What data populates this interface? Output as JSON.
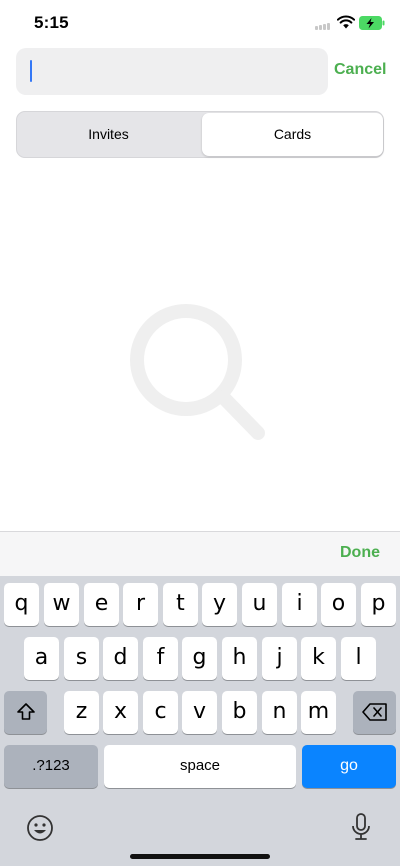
{
  "status_bar": {
    "time": "5:15",
    "icons": [
      "cellular-signal-icon",
      "wifi-icon",
      "battery-charging-icon"
    ]
  },
  "search": {
    "value": "",
    "placeholder": "",
    "cancel_label": "Cancel"
  },
  "segments": {
    "items": [
      {
        "label": "Invites",
        "selected": false
      },
      {
        "label": "Cards",
        "selected": true
      }
    ]
  },
  "empty_state": {
    "icon": "search-icon"
  },
  "accessory": {
    "done_label": "Done"
  },
  "keyboard": {
    "row1": [
      "q",
      "w",
      "e",
      "r",
      "t",
      "y",
      "u",
      "i",
      "o",
      "p"
    ],
    "row2": [
      "a",
      "s",
      "d",
      "f",
      "g",
      "h",
      "j",
      "k",
      "l"
    ],
    "row3": [
      "z",
      "x",
      "c",
      "v",
      "b",
      "n",
      "m"
    ],
    "numbers_label": ".?123",
    "space_label": "space",
    "go_label": "go",
    "shift_icon": "shift-icon",
    "delete_icon": "backspace-icon",
    "emoji_icon": "emoji-icon",
    "mic_icon": "microphone-icon"
  },
  "colors": {
    "accent": "#4caf50",
    "caret": "#3478f6",
    "go_key": "#0a84ff",
    "keyboard_bg": "#d3d6dc"
  }
}
